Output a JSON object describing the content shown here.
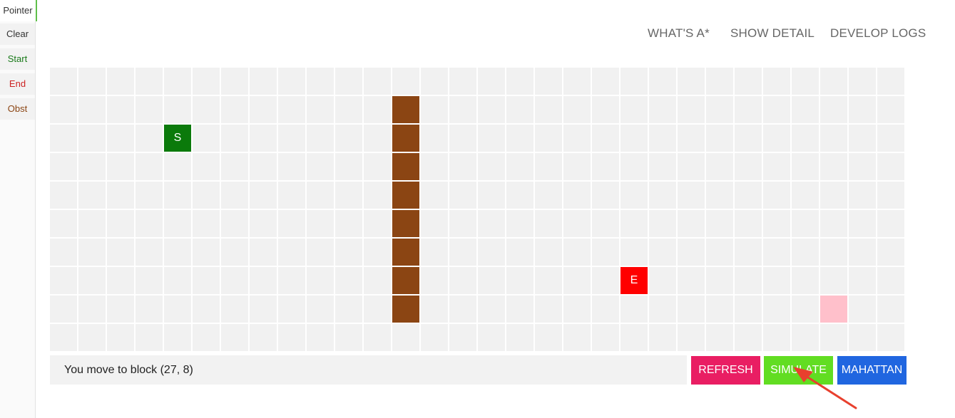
{
  "sidebar": {
    "tools": [
      {
        "label": "Pointer",
        "color": "#333333",
        "active": true
      },
      {
        "label": "Clear",
        "color": "#333333",
        "active": false
      },
      {
        "label": "Start",
        "color": "#1a7a1a",
        "active": false
      },
      {
        "label": "End",
        "color": "#cc2222",
        "active": false
      },
      {
        "label": "Obst",
        "color": "#8b4513",
        "active": false
      }
    ]
  },
  "nav": {
    "whats_astar": "WHAT'S A*",
    "show_detail": "SHOW DETAIL",
    "develop_logs": "DEVELOP LOGS"
  },
  "grid": {
    "cols": 30,
    "rows": 10,
    "colors": {
      "empty": "#f1f1f1",
      "start": "#0b7a0b",
      "end": "#ff0000",
      "obstacle": "#8b4513",
      "hover": "#ffc0cb"
    },
    "start": {
      "col": 4,
      "row": 2,
      "label": "S"
    },
    "end": {
      "col": 20,
      "row": 7,
      "label": "E"
    },
    "hover": {
      "col": 27,
      "row": 8
    },
    "obstacles": [
      [
        12,
        1
      ],
      [
        12,
        2
      ],
      [
        12,
        3
      ],
      [
        12,
        4
      ],
      [
        12,
        5
      ],
      [
        12,
        6
      ],
      [
        12,
        7
      ],
      [
        12,
        8
      ]
    ]
  },
  "status": {
    "message": "You move to block (27, 8)"
  },
  "buttons": {
    "refresh": {
      "label": "REFRESH",
      "color": "#e91e63"
    },
    "simulate": {
      "label": "SIMULATE",
      "color": "#62dd22"
    },
    "manhattan": {
      "label": "MAHATTAN",
      "color": "#2066e0"
    }
  }
}
